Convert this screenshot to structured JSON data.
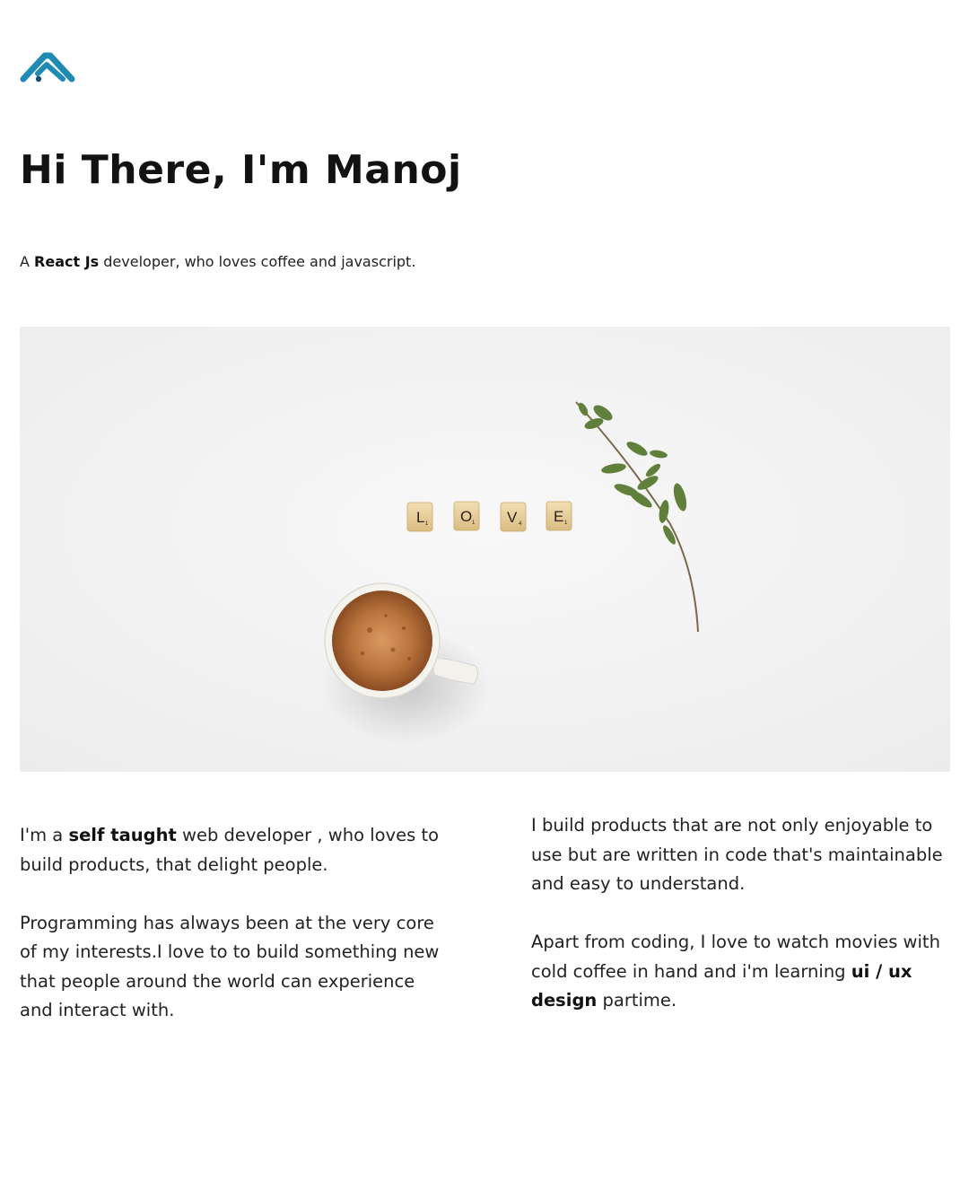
{
  "brand": {
    "logo_icon": "chevron-mountain-logo-icon",
    "accent_color": "#1f8bb4"
  },
  "hero": {
    "title": "Hi There, I'm Manoj",
    "tagline": {
      "prefix": "A ",
      "strong": "React Js",
      "suffix": " developer, who loves coffee and javascript."
    }
  },
  "image": {
    "alt": "Coffee cup with scrabble tiles spelling LOVE and a green twig",
    "tiles": [
      {
        "letter": "L",
        "score": "1"
      },
      {
        "letter": "O",
        "score": "1"
      },
      {
        "letter": "V",
        "score": "4"
      },
      {
        "letter": "E",
        "score": "1"
      }
    ]
  },
  "about": {
    "left": {
      "p1": {
        "prefix": "I'm a ",
        "strong": "self taught",
        "suffix": " web developer , who loves to build products, that delight people."
      },
      "p2": "Programming has always been at the very core of my interests.I love to to build something new that people around the world can experience and interact with."
    },
    "right": {
      "p1": "I build products that are not only enjoyable to use but are written in code that's maintainable and easy to understand.",
      "p2": {
        "prefix": "Apart from coding, I love to watch movies with cold coffee in hand and i'm learning ",
        "strong": "ui / ux design",
        "suffix": " partime."
      }
    }
  }
}
